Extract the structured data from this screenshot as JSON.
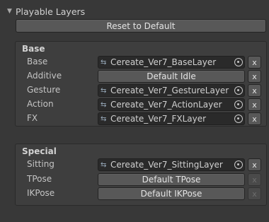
{
  "section": {
    "title": "Playable Layers",
    "arrow": "▼"
  },
  "reset_button": "Reset to Default",
  "base_group": {
    "title": "Base",
    "rows": [
      {
        "label": "Base",
        "kind": "field",
        "value": "Cereate_Ver7_BaseLayer",
        "icon": "animator-controller-icon",
        "x": "x",
        "x_enabled": true
      },
      {
        "label": "Additive",
        "kind": "button",
        "value": "Default Idle",
        "x": "x",
        "x_enabled": true
      },
      {
        "label": "Gesture",
        "kind": "field",
        "value": "Cereate_Ver7_GestureLayer",
        "icon": "animator-controller-icon",
        "x": "x",
        "x_enabled": true
      },
      {
        "label": "Action",
        "kind": "field",
        "value": "Cereate_Ver7_ActionLayer",
        "icon": "animator-controller-icon",
        "x": "x",
        "x_enabled": true
      },
      {
        "label": "FX",
        "kind": "field",
        "value": "Cereate_Ver7_FXLayer",
        "icon": "animator-controller-icon",
        "x": "x",
        "x_enabled": true
      }
    ]
  },
  "special_group": {
    "title": "Special",
    "rows": [
      {
        "label": "Sitting",
        "kind": "field",
        "value": "Cereate_Ver7_SittingLayer",
        "icon": "animator-controller-icon",
        "x": "x",
        "x_enabled": true
      },
      {
        "label": "TPose",
        "kind": "button",
        "value": "Default TPose",
        "x": "x",
        "x_enabled": false
      },
      {
        "label": "IKPose",
        "kind": "button",
        "value": "Default IKPose",
        "x": "x",
        "x_enabled": false
      }
    ]
  }
}
